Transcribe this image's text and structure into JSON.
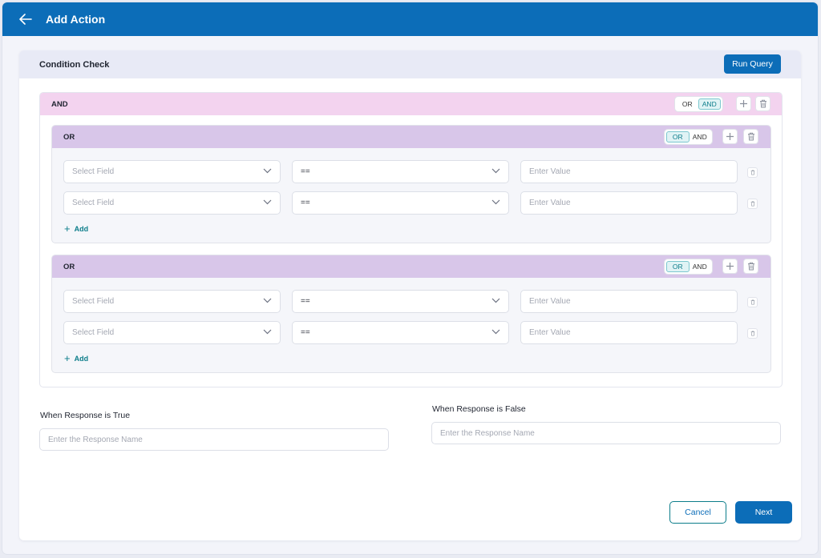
{
  "header": {
    "title": "Add Action",
    "back_icon": "arrow-left-icon"
  },
  "condition_check": {
    "title": "Condition Check",
    "run_query_label": "Run Query",
    "root_group": {
      "label": "AND",
      "toggle": {
        "options": [
          "OR",
          "AND"
        ],
        "selected": "AND"
      },
      "subgroups": [
        {
          "label": "OR",
          "toggle": {
            "options": [
              "OR",
              "AND"
            ],
            "selected": "OR"
          },
          "conditions": [
            {
              "field_placeholder": "Select Field",
              "operator": "==",
              "value_placeholder": "Enter Value"
            },
            {
              "field_placeholder": "Select Field",
              "operator": "==",
              "value_placeholder": "Enter Value"
            }
          ],
          "add_label": "Add"
        },
        {
          "label": "OR",
          "toggle": {
            "options": [
              "OR",
              "AND"
            ],
            "selected": "OR"
          },
          "conditions": [
            {
              "field_placeholder": "Select Field",
              "operator": "==",
              "value_placeholder": "Enter Value"
            },
            {
              "field_placeholder": "Select Field",
              "operator": "==",
              "value_placeholder": "Enter Value"
            }
          ],
          "add_label": "Add"
        }
      ]
    }
  },
  "responses": {
    "true_label": "When Response is True",
    "true_placeholder": "Enter the Response Name",
    "false_label": "When Response is False",
    "false_placeholder": "Enter the Response Name"
  },
  "footer": {
    "cancel_label": "Cancel",
    "next_label": "Next"
  },
  "colors": {
    "primary": "#0c6db8",
    "and_header": "#f3d3ef",
    "or_header": "#d8c6e9",
    "toggle_active": "#0c7d8a"
  }
}
